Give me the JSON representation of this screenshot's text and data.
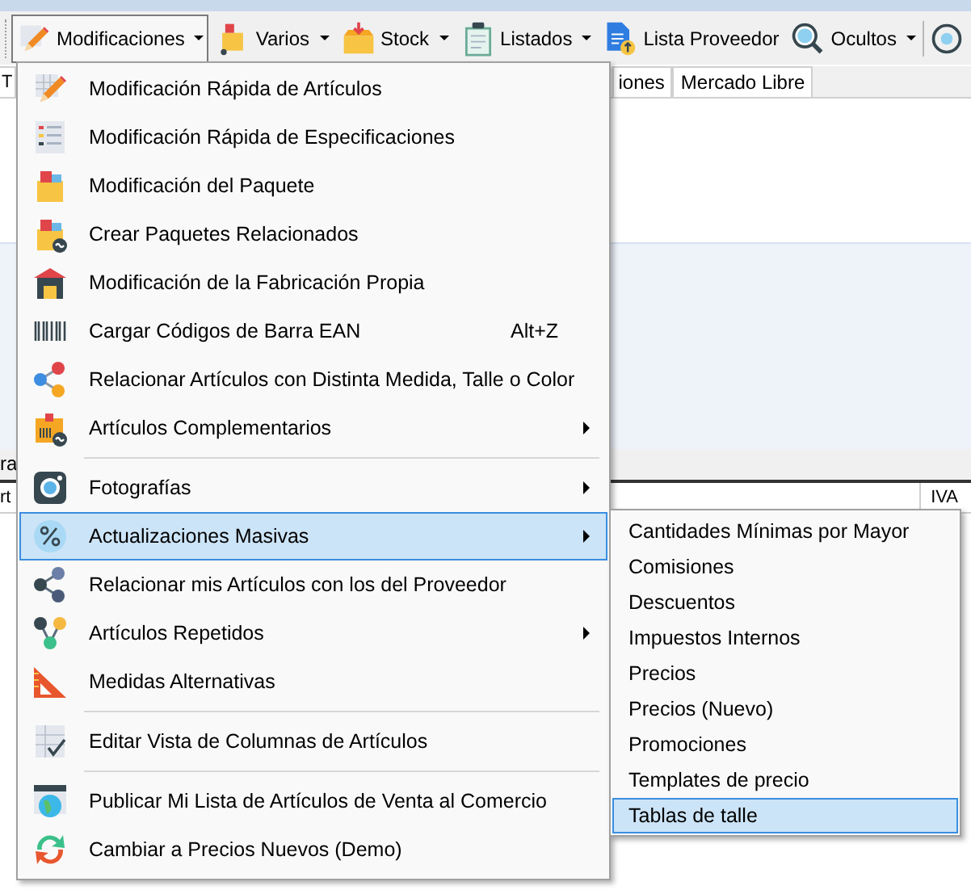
{
  "toolbar": {
    "items": [
      {
        "label": "Modificaciones",
        "dropdown": true,
        "selected": true
      },
      {
        "label": "Varios",
        "dropdown": true,
        "selected": false
      },
      {
        "label": "Stock",
        "dropdown": true,
        "selected": false
      },
      {
        "label": "Listados",
        "dropdown": true,
        "selected": false
      },
      {
        "label": "Lista Proveedor",
        "dropdown": false,
        "selected": false
      },
      {
        "label": "Ocultos",
        "dropdown": true,
        "selected": false
      }
    ]
  },
  "tabs": [
    {
      "label": "T"
    },
    {
      "label": "iones"
    },
    {
      "label": "Mercado Libre"
    }
  ],
  "grid": {
    "row_text": "ra",
    "columns": [
      "rt",
      "IVA"
    ]
  },
  "menu": {
    "items": [
      {
        "kind": "item",
        "label": "Modificación Rápida de Artículos",
        "submenu": false,
        "selected": false
      },
      {
        "kind": "item",
        "label": "Modificación Rápida de Especificaciones",
        "submenu": false,
        "selected": false
      },
      {
        "kind": "item",
        "label": "Modificación del Paquete",
        "submenu": false,
        "selected": false
      },
      {
        "kind": "item",
        "label": "Crear Paquetes Relacionados",
        "submenu": false,
        "selected": false
      },
      {
        "kind": "item",
        "label": "Modificación de la Fabricación Propia",
        "submenu": false,
        "selected": false
      },
      {
        "kind": "item",
        "label": "Cargar Códigos de Barra EAN",
        "shortcut": "Alt+Z",
        "submenu": false,
        "selected": false
      },
      {
        "kind": "item",
        "label": "Relacionar Artículos con Distinta Medida, Talle o Color",
        "submenu": false,
        "selected": false
      },
      {
        "kind": "item",
        "label": "Artículos Complementarios",
        "submenu": true,
        "selected": false
      },
      {
        "kind": "separator"
      },
      {
        "kind": "item",
        "label": "Fotografías",
        "submenu": true,
        "selected": false
      },
      {
        "kind": "item",
        "label": "Actualizaciones Masivas",
        "submenu": true,
        "selected": true
      },
      {
        "kind": "item",
        "label": "Relacionar mis Artículos con los del Proveedor",
        "submenu": false,
        "selected": false
      },
      {
        "kind": "item",
        "label": "Artículos Repetidos",
        "submenu": true,
        "selected": false
      },
      {
        "kind": "item",
        "label": "Medidas Alternativas",
        "submenu": false,
        "selected": false
      },
      {
        "kind": "separator"
      },
      {
        "kind": "item",
        "label": "Editar Vista de Columnas de Artículos",
        "submenu": false,
        "selected": false
      },
      {
        "kind": "separator"
      },
      {
        "kind": "item",
        "label": "Publicar Mi Lista de Artículos de Venta al Comercio",
        "submenu": false,
        "selected": false
      },
      {
        "kind": "item",
        "label": "Cambiar a Precios Nuevos (Demo)",
        "submenu": false,
        "selected": false
      }
    ]
  },
  "submenu": {
    "items": [
      {
        "label": "Cantidades Mínimas por Mayor",
        "selected": false
      },
      {
        "label": "Comisiones",
        "selected": false
      },
      {
        "label": "Descuentos",
        "selected": false
      },
      {
        "label": "Impuestos Internos",
        "selected": false
      },
      {
        "label": "Precios",
        "selected": false
      },
      {
        "label": "Precios (Nuevo)",
        "selected": false
      },
      {
        "label": "Promociones",
        "selected": false
      },
      {
        "label": "Templates de precio",
        "selected": false
      },
      {
        "label": "Tablas de talle",
        "selected": true
      }
    ]
  }
}
